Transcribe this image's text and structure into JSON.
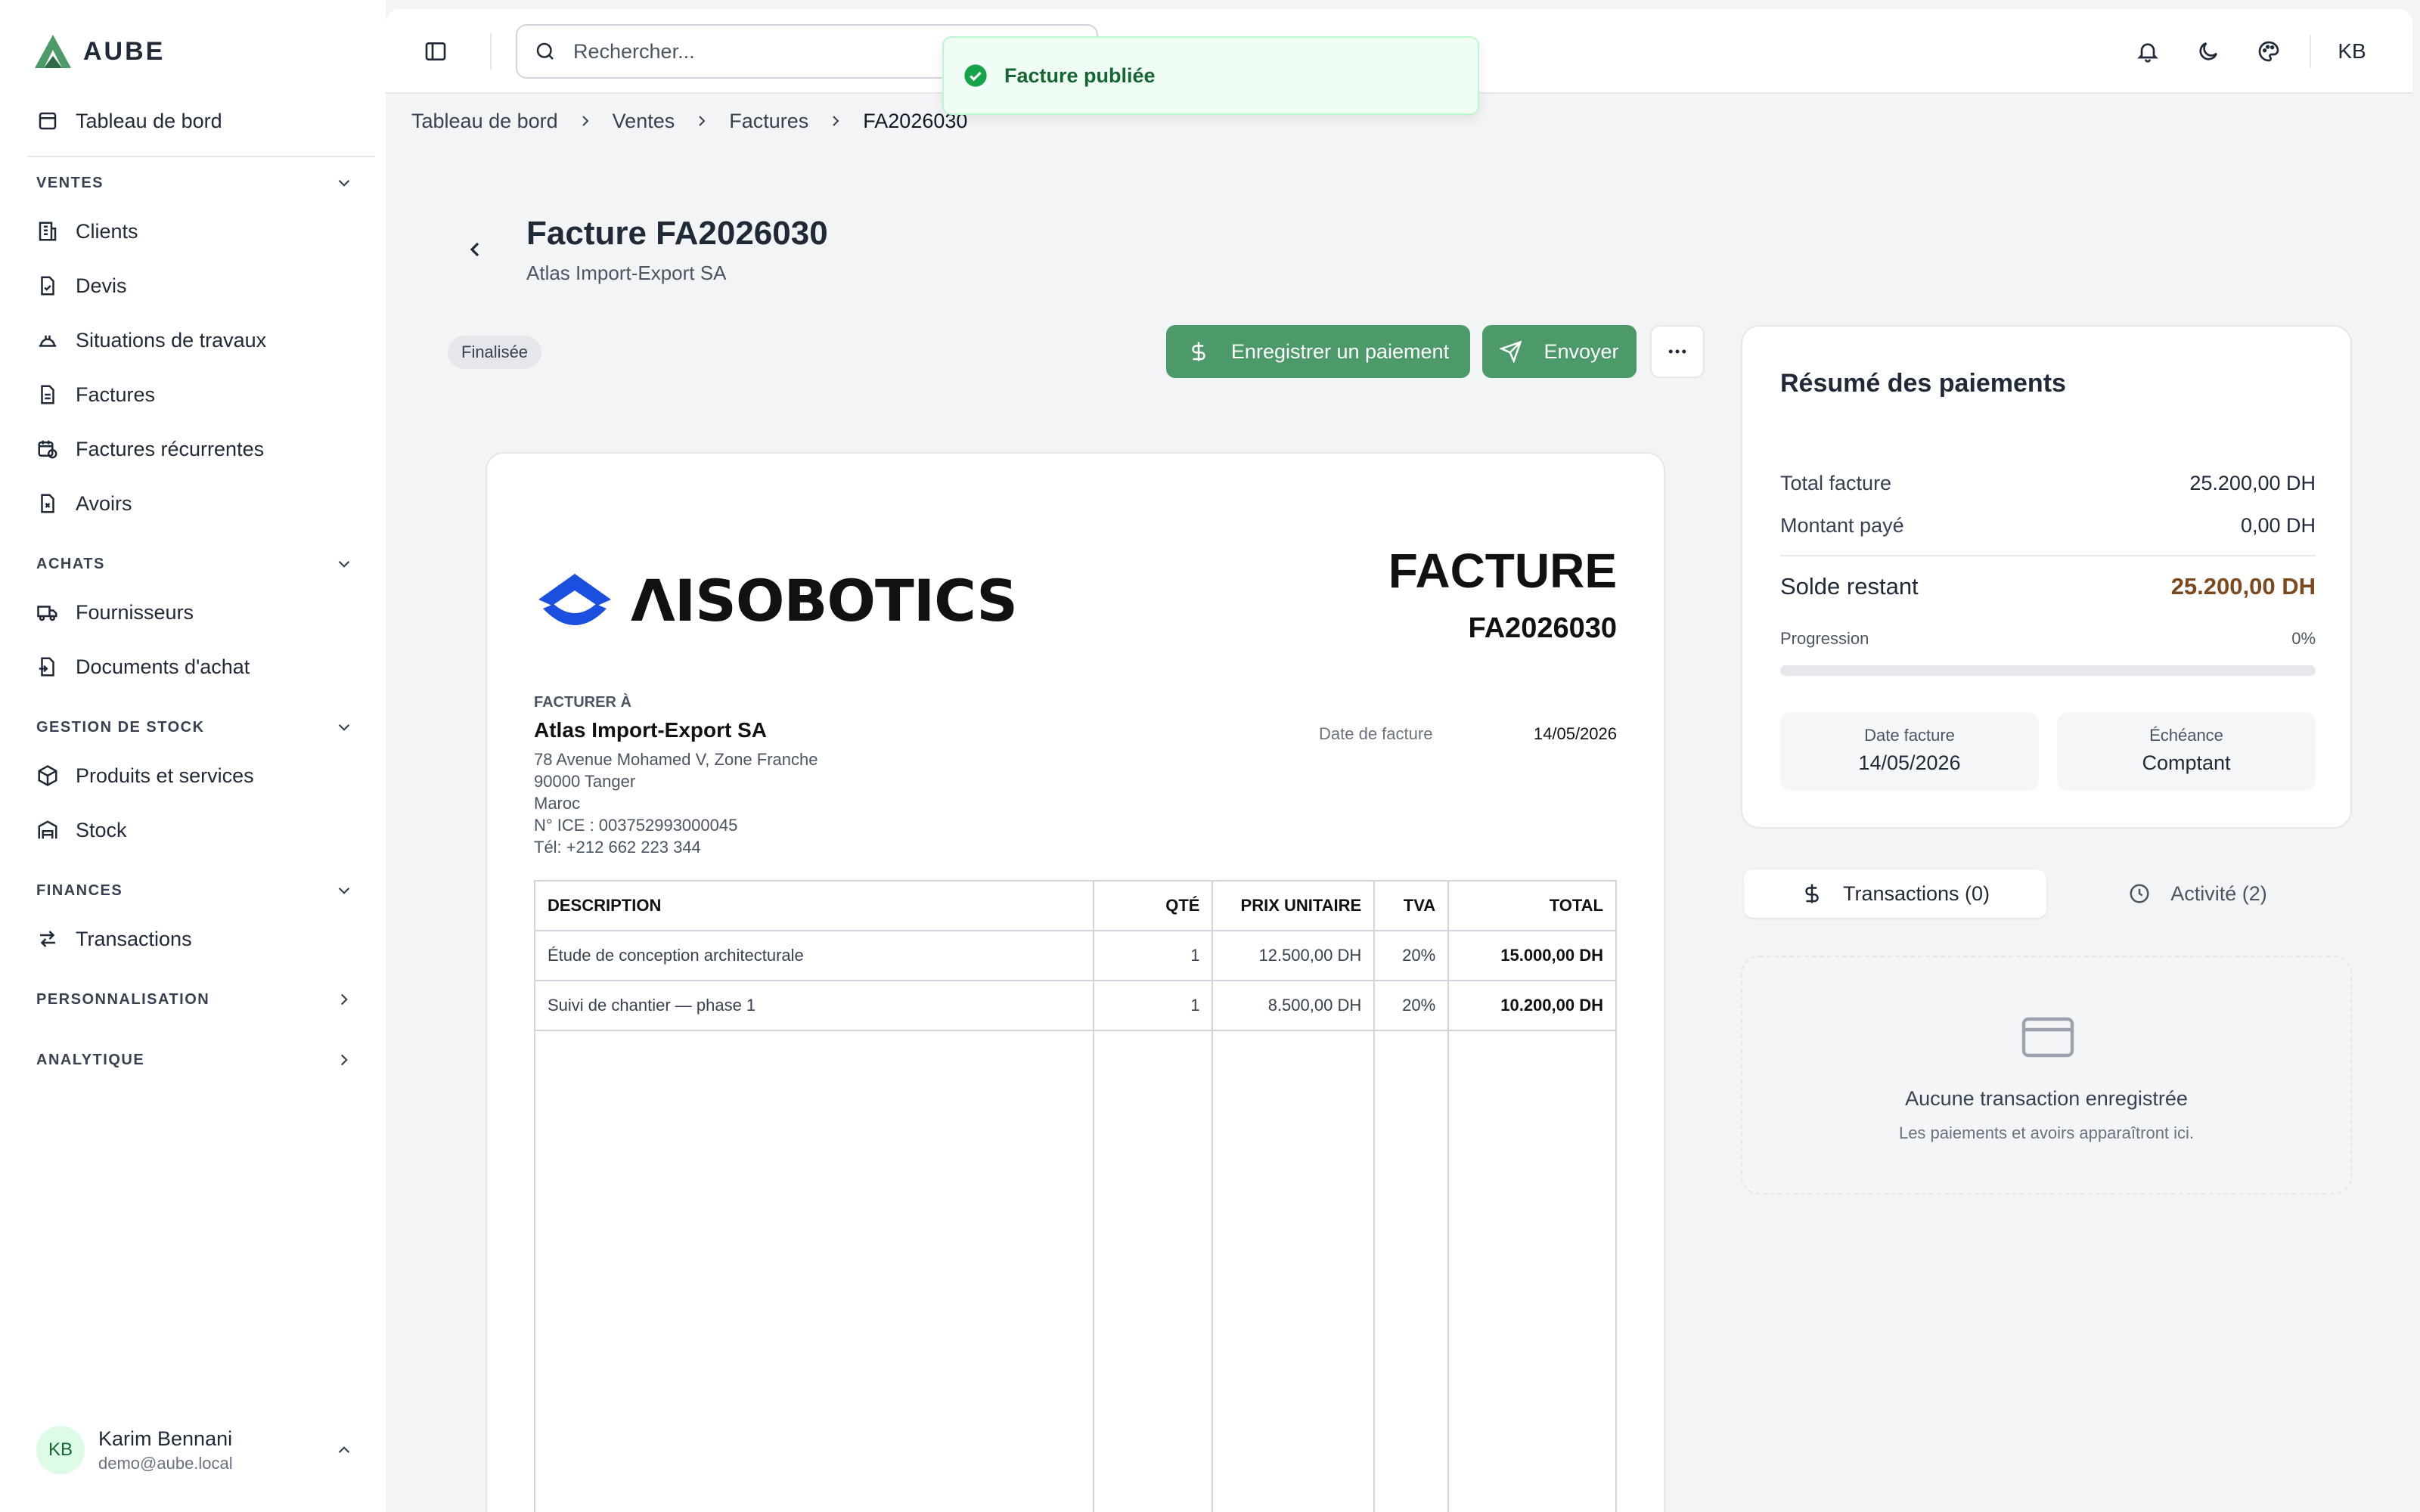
{
  "app": {
    "name": "AUBE"
  },
  "sidebar": {
    "dashboard": "Tableau de bord",
    "sections": {
      "ventes": "VENTES",
      "achats": "ACHATS",
      "stock": "GESTION DE STOCK",
      "finances": "FINANCES",
      "perso": "PERSONNALISATION",
      "analytique": "ANALYTIQUE"
    },
    "items": {
      "clients": "Clients",
      "devis": "Devis",
      "situations": "Situations de travaux",
      "factures": "Factures",
      "recurrentes": "Factures récurrentes",
      "avoirs": "Avoirs",
      "fournisseurs": "Fournisseurs",
      "documents_achat": "Documents d'achat",
      "produits": "Produits et services",
      "stock": "Stock",
      "transactions": "Transactions"
    },
    "user": {
      "initials": "KB",
      "name": "Karim Bennani",
      "email": "demo@aube.local"
    }
  },
  "topbar": {
    "search_placeholder": "Rechercher...",
    "user_initials": "KB"
  },
  "toast": {
    "message": "Facture publiée"
  },
  "breadcrumb": [
    "Tableau de bord",
    "Ventes",
    "Factures",
    "FA2026030"
  ],
  "header": {
    "title": "Facture FA2026030",
    "subtitle": "Atlas Import-Export SA",
    "status": "Finalisée",
    "pay_button": "Enregistrer un paiement",
    "send_button": "Envoyer"
  },
  "invoice": {
    "logo_text": "ΛISOBOTICS",
    "doc_type": "FACTURE",
    "number": "FA2026030",
    "bill_to_label": "FACTURER À",
    "client_name": "Atlas Import-Export SA",
    "client_address": [
      "78 Avenue Mohamed V, Zone Franche",
      "90000 Tanger",
      "Maroc",
      "N° ICE : 003752993000045",
      "Tél: +212 662 223 344"
    ],
    "date_label": "Date de facture",
    "date_value": "14/05/2026",
    "columns": [
      "DESCRIPTION",
      "QTÉ",
      "PRIX UNITAIRE",
      "TVA",
      "TOTAL"
    ],
    "rows": [
      {
        "description": "Étude de conception architecturale",
        "qty": "1",
        "unit_price": "12.500,00 DH",
        "tva": "20%",
        "total": "15.000,00 DH"
      },
      {
        "description": "Suivi de chantier — phase 1",
        "qty": "1",
        "unit_price": "8.500,00 DH",
        "tva": "20%",
        "total": "10.200,00 DH"
      }
    ]
  },
  "summary": {
    "title": "Résumé des paiements",
    "total_label": "Total facture",
    "total_value": "25.200,00 DH",
    "paid_label": "Montant payé",
    "paid_value": "0,00 DH",
    "balance_label": "Solde restant",
    "balance_value": "25.200,00 DH",
    "progress_label": "Progression",
    "progress_text": "0%",
    "progress_percent": 0,
    "date_label": "Date facture",
    "date_value": "14/05/2026",
    "due_label": "Échéance",
    "due_value": "Comptant",
    "accent_color": "#4c9a6a",
    "balance_color": "#7c4a1e"
  },
  "tabs": {
    "transactions": "Transactions (0)",
    "activity": "Activité (2)"
  },
  "empty": {
    "title": "Aucune transaction enregistrée",
    "subtitle": "Les paiements et avoirs apparaîtront ici."
  }
}
